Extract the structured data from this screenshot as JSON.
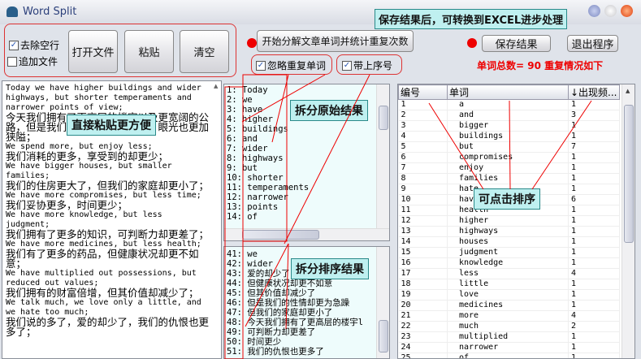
{
  "window": {
    "title": "Word Split"
  },
  "toolbar": {
    "remove_blank_lines": {
      "label": "去除空行",
      "checked": true
    },
    "append_file": {
      "label": "追加文件",
      "checked": false
    },
    "open_file": "打开文件",
    "paste": "粘贴",
    "clear": "清空",
    "start_split": "开始分解文章单词并统计重复次数",
    "ignore_duplicates": {
      "label": "忽略重复单词",
      "checked": true
    },
    "with_index": {
      "label": "带上序号",
      "checked": true
    },
    "save_result": "保存结果",
    "exit": "退出程序",
    "summary": "单词总数= 90  重复情况如下"
  },
  "callouts": {
    "save": "保存结果后，可转换到EXCEL进步处理",
    "paste": "直接粘贴更方便",
    "split_raw": "拆分原始结果",
    "split_sorted": "拆分排序结果",
    "sortable": "可点击排序"
  },
  "source_text": [
    {
      "t": "Today we have higher buildings and wider highways, but shorter temperaments and narrower points of view;",
      "zh": false
    },
    {
      "t": "今天我们拥有了更高层的楼宇以及更宽阔的公路，但是我们的性情却更为急躁，眼光也更加狭隘；",
      "zh": true
    },
    {
      "t": "We spend more, but enjoy less;",
      "zh": false
    },
    {
      "t": "我们消耗的更多，享受到的却更少；",
      "zh": true
    },
    {
      "t": "We have bigger houses, but smaller families;",
      "zh": false
    },
    {
      "t": "我们的住房更大了，但我们的家庭却更小了；",
      "zh": true
    },
    {
      "t": "We have more compromises, but less time;",
      "zh": false
    },
    {
      "t": "我们妥协更多，时间更少；",
      "zh": true
    },
    {
      "t": "We have more knowledge, but less judgment;",
      "zh": false
    },
    {
      "t": "我们拥有了更多的知识，可判断力却更差了；",
      "zh": true
    },
    {
      "t": "We have more medicines, but less health;",
      "zh": false
    },
    {
      "t": "我们有了更多的药品，但健康状况却更不如意；",
      "zh": true
    },
    {
      "t": "We have multiplied out possessions, but reduced out values;",
      "zh": false
    },
    {
      "t": "我们拥有的财富倍增，但其价值却减少了；",
      "zh": true
    },
    {
      "t": "We talk much, we love only a little, and we hate too much;",
      "zh": false
    },
    {
      "t": "我们说的多了，爱的却少了，我们的仇恨也更多了；",
      "zh": true
    }
  ],
  "raw_split": [
    "1: Today",
    "2: we",
    "3: have",
    "4: higher",
    "5: buildings",
    "6: and",
    "7: wider",
    "8: highways",
    "9: but",
    "10: shorter",
    "11: temperaments",
    "12: narrower",
    "13: points",
    "14: of"
  ],
  "sorted_split": [
    "41: we",
    "42: wider",
    "43: 爱的却少了",
    "44: 但健康状况却更不如意",
    "45: 但其价值却减少了",
    "46: 但是我们的性情却更为急躁",
    "47: 但我们的家庭却更小了",
    "48: 今天我们拥有了更高层的楼宇l",
    "49: 可判断力却更差了",
    "50: 时间更少",
    "51: 我们的仇恨也更多了"
  ],
  "table": {
    "columns": [
      "编号",
      "单词",
      "↓出现频..."
    ],
    "rows": [
      [
        "1",
        "a",
        "1"
      ],
      [
        "2",
        "and",
        "3"
      ],
      [
        "3",
        "bigger",
        "1"
      ],
      [
        "4",
        "buildings",
        "1"
      ],
      [
        "5",
        "but",
        "7"
      ],
      [
        "6",
        "compromises",
        "1"
      ],
      [
        "7",
        "enjoy",
        "1"
      ],
      [
        "8",
        "families",
        "1"
      ],
      [
        "9",
        "hate",
        "1"
      ],
      [
        "10",
        "have",
        "6"
      ],
      [
        "11",
        "health",
        "1"
      ],
      [
        "12",
        "higher",
        "1"
      ],
      [
        "13",
        "highways",
        "1"
      ],
      [
        "14",
        "houses",
        "1"
      ],
      [
        "15",
        "judgment",
        "1"
      ],
      [
        "16",
        "knowledge",
        "1"
      ],
      [
        "17",
        "less",
        "4"
      ],
      [
        "18",
        "little",
        "1"
      ],
      [
        "19",
        "love",
        "1"
      ],
      [
        "20",
        "medicines",
        "1"
      ],
      [
        "21",
        "more",
        "4"
      ],
      [
        "22",
        "much",
        "2"
      ],
      [
        "23",
        "multiplied",
        "1"
      ],
      [
        "24",
        "narrower",
        "1"
      ],
      [
        "25",
        "of",
        "1"
      ]
    ]
  },
  "colors": {
    "annotation": "#e00000",
    "callout_bg": "#bff0f0"
  }
}
